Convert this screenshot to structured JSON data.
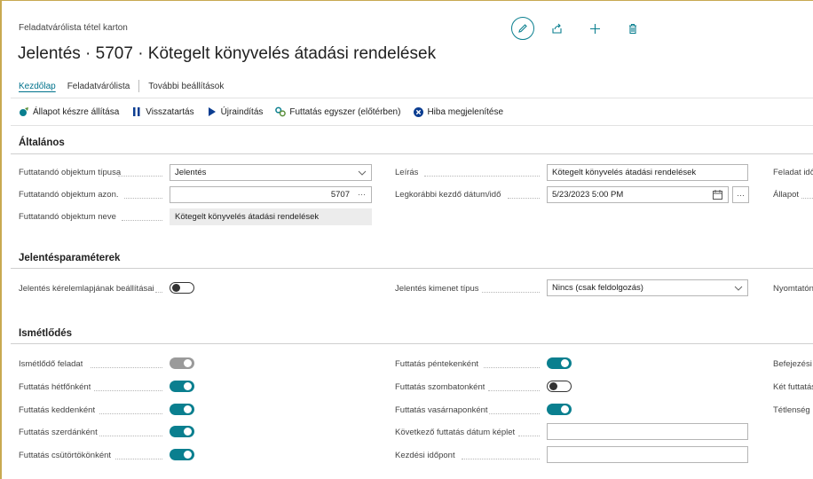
{
  "page": {
    "caption": "Feladatvárólista tétel karton",
    "title": "Jelentés · 5707 · Kötegelt könyvelés átadási rendelések"
  },
  "header_icons": [
    "edit-icon",
    "share-icon",
    "plus-icon",
    "delete-icon"
  ],
  "tabs": [
    "Kezdőlap",
    "Feladatvárólista",
    "További beállítások"
  ],
  "actions": [
    {
      "label": "Állapot készre állítása",
      "icon": "ready-status-icon"
    },
    {
      "label": "Visszatartás",
      "icon": "pause-icon"
    },
    {
      "label": "Újraindítás",
      "icon": "play-icon"
    },
    {
      "label": "Futtatás egyszer (előtérben)",
      "icon": "run-once-icon"
    },
    {
      "label": "Hiba megjelenítése",
      "icon": "error-icon"
    }
  ],
  "sections": {
    "general": "Általános",
    "report_params": "Jelentésparaméterek",
    "recurrence": "Ismétlődés"
  },
  "general": {
    "object_type_label": "Futtatandó objektum típusa",
    "object_type_value": "Jelentés",
    "object_id_label": "Futtatandó objektum azon.",
    "object_id_value": "5707",
    "object_name_label": "Futtatandó objektum neve",
    "object_name_value": "Kötegelt könyvelés átadási rendelések",
    "description_label": "Leírás",
    "description_value": "Kötegelt könyvelés átadási rendelések",
    "earliest_start_label": "Legkorábbi kezdő dátum/idő",
    "earliest_start_value": "5/23/2023 5:00 PM",
    "task_time_label": "Feladat idő",
    "status_label": "Állapot"
  },
  "report": {
    "request_page_label": "Jelentés kérelemlapjának beállításai",
    "output_type_label": "Jelentés kimenet típus",
    "output_type_value": "Nincs (csak feldolgozás)",
    "printer_label": "Nyomtatón"
  },
  "recurrence": {
    "recurring_label": "Ismétlődő feladat",
    "monday_label": "Futtatás hétfőnként",
    "tuesday_label": "Futtatás keddenként",
    "wednesday_label": "Futtatás szerdánként",
    "thursday_label": "Futtatás csütörtökönként",
    "friday_label": "Futtatás péntekenként",
    "saturday_label": "Futtatás szombatonként",
    "sunday_label": "Futtatás vasárnaponként",
    "next_run_formula_label": "Következő futtatás dátum képlet",
    "start_time_label": "Kezdési időpont",
    "end_time_label": "Befejezési i",
    "between_runs_label": "Két futtatás",
    "inactivity_label": "Tétlenség id"
  },
  "toggles": {
    "request_page": false,
    "recurring": true,
    "monday": true,
    "tuesday": true,
    "wednesday": true,
    "thursday": true,
    "friday": true,
    "saturday": false,
    "sunday": true
  },
  "colors": {
    "accent": "#0a7f8f",
    "frame": "#c8a951"
  }
}
